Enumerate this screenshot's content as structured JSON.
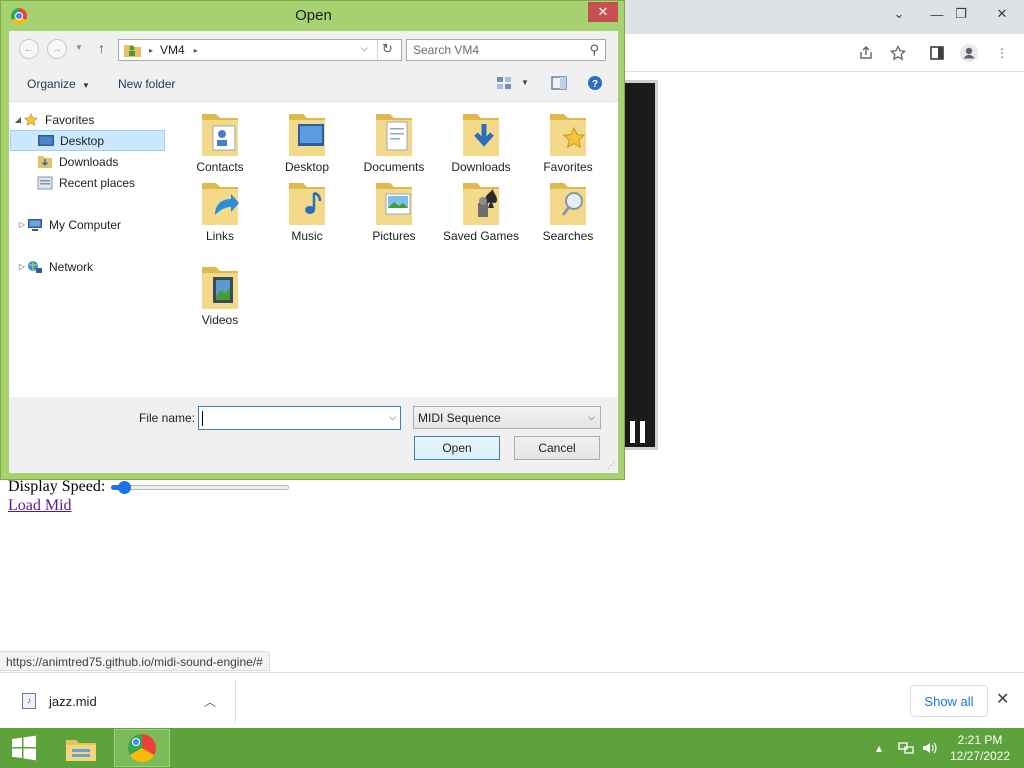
{
  "browser": {
    "status_url": "https://animtred75.github.io/midi-sound-engine/#",
    "page": {
      "speed_label": "Display Speed:",
      "speed_value": 0.04,
      "load_link": "Load Mid"
    },
    "download_bar": {
      "file_name": "jazz.mid",
      "show_all": "Show all"
    }
  },
  "dialog": {
    "title": "Open",
    "address": {
      "segments": [
        "VM4"
      ]
    },
    "search_placeholder": "Search VM4",
    "commands": {
      "organize": "Organize",
      "new_folder": "New folder"
    },
    "tree": {
      "favorites": "Favorites",
      "desktop": "Desktop",
      "downloads": "Downloads",
      "recent": "Recent places",
      "computer": "My Computer",
      "network": "Network"
    },
    "folders": [
      {
        "label": "Contacts",
        "icon": "contacts-folder-icon"
      },
      {
        "label": "Desktop",
        "icon": "desktop-folder-icon"
      },
      {
        "label": "Documents",
        "icon": "documents-folder-icon"
      },
      {
        "label": "Downloads",
        "icon": "downloads-folder-icon"
      },
      {
        "label": "Favorites",
        "icon": "favorites-folder-icon"
      },
      {
        "label": "Links",
        "icon": "links-folder-icon"
      },
      {
        "label": "Music",
        "icon": "music-folder-icon"
      },
      {
        "label": "Pictures",
        "icon": "pictures-folder-icon"
      },
      {
        "label": "Saved Games",
        "icon": "saved-games-folder-icon"
      },
      {
        "label": "Searches",
        "icon": "searches-folder-icon"
      },
      {
        "label": "Videos",
        "icon": "videos-folder-icon"
      }
    ],
    "file_name_label": "File name:",
    "file_name_value": "",
    "file_type": "MIDI Sequence",
    "open_button": "Open",
    "cancel_button": "Cancel"
  },
  "taskbar": {
    "time": "2:21 PM",
    "date": "12/27/2022"
  },
  "colors": {
    "dialog_frame": "#a6d36f",
    "taskbar": "#5da23a",
    "close_red": "#c75050",
    "selection": "#cce8ff",
    "link_visited": "#551a8b",
    "accent_blue": "#1a73e8"
  }
}
